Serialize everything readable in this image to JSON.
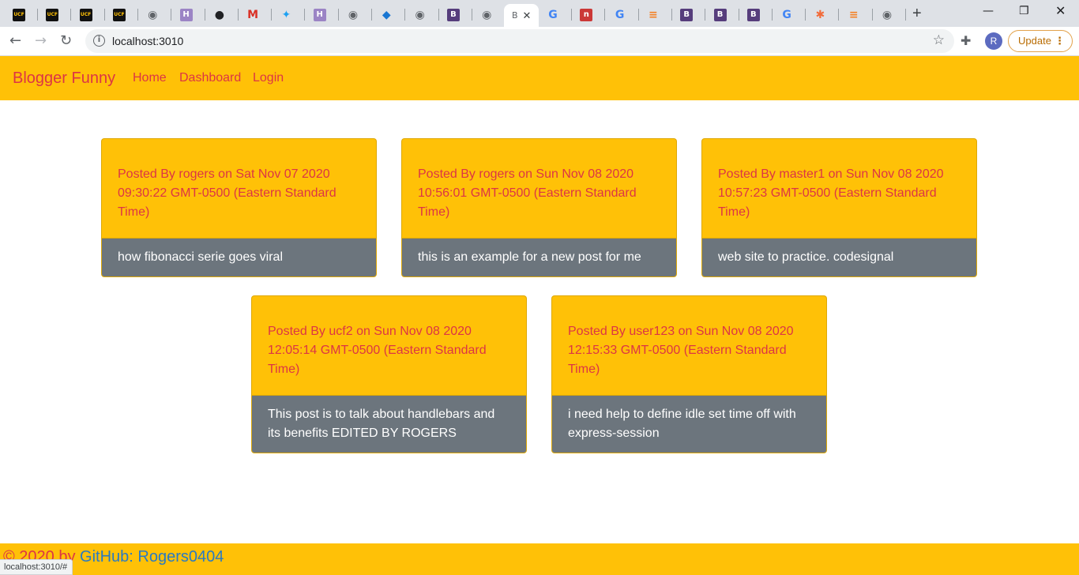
{
  "browser": {
    "tabs": [
      {
        "icon": "ucf-icon",
        "letter": "UCF",
        "color": "#111111"
      },
      {
        "icon": "ucf-icon",
        "letter": "UCF",
        "color": "#111111"
      },
      {
        "icon": "ucf-icon",
        "letter": "UCF",
        "color": "#111111"
      },
      {
        "icon": "ucf-icon",
        "letter": "UCF",
        "color": "#111111"
      },
      {
        "icon": "globe-icon",
        "letter": "◉",
        "color": "#5f6368"
      },
      {
        "icon": "heroku-icon",
        "letter": "H",
        "color": "#9b84c5"
      },
      {
        "icon": "github-icon",
        "letter": "●",
        "color": "#202124"
      },
      {
        "icon": "gmail-icon",
        "letter": "M",
        "color": "#d93025"
      },
      {
        "icon": "twitter-icon",
        "letter": "✦",
        "color": "#1da1f2"
      },
      {
        "icon": "heroku-icon",
        "letter": "H",
        "color": "#9b84c5"
      },
      {
        "icon": "globe-icon",
        "letter": "◉",
        "color": "#5f6368"
      },
      {
        "icon": "cube-icon",
        "letter": "◆",
        "color": "#1976d2"
      },
      {
        "icon": "globe-icon",
        "letter": "◉",
        "color": "#5f6368"
      },
      {
        "icon": "bootstrap-icon",
        "letter": "B",
        "color": "#563d7c"
      },
      {
        "icon": "globe-icon",
        "letter": "◉",
        "color": "#5f6368"
      }
    ],
    "tabs_right": [
      {
        "icon": "google-icon",
        "letter": "G",
        "color": "#4285f4"
      },
      {
        "icon": "npm-icon",
        "letter": "n",
        "color": "#cb3837"
      },
      {
        "icon": "google-icon",
        "letter": "G",
        "color": "#4285f4"
      },
      {
        "icon": "stackoverflow-icon",
        "letter": "≡",
        "color": "#f48024"
      },
      {
        "icon": "bootstrap-icon",
        "letter": "B",
        "color": "#563d7c"
      },
      {
        "icon": "bootstrap-icon",
        "letter": "B",
        "color": "#563d7c"
      },
      {
        "icon": "bootstrap-icon",
        "letter": "B",
        "color": "#563d7c"
      },
      {
        "icon": "google-icon",
        "letter": "G",
        "color": "#4285f4"
      },
      {
        "icon": "asterisk-icon",
        "letter": "✱",
        "color": "#f26b3a"
      },
      {
        "icon": "stackoverflow-icon",
        "letter": "≡",
        "color": "#f48024"
      },
      {
        "icon": "globe-icon",
        "letter": "◉",
        "color": "#5f6368"
      }
    ],
    "active_tab_letter": "B",
    "url": "localhost:3010",
    "update_label": "Update",
    "avatar_letter": "R",
    "status_url": "localhost:3010/#"
  },
  "app": {
    "brand": "Blogger Funny",
    "nav": [
      "Home",
      "Dashboard",
      "Login"
    ],
    "posts": [
      {
        "header": "Posted By rogers on Sat Nov 07 2020 09:30:22 GMT-0500 (Eastern Standard Time)",
        "body": "how fibonacci serie goes viral"
      },
      {
        "header": "Posted By rogers on Sun Nov 08 2020 10:56:01 GMT-0500 (Eastern Standard Time)",
        "body": "this is an example for a new post for me"
      },
      {
        "header": "Posted By master1 on Sun Nov 08 2020 10:57:23 GMT-0500 (Eastern Standard Time)",
        "body": "web site to practice. codesignal"
      },
      {
        "header": "Posted By ucf2 on Sun Nov 08 2020 12:05:14 GMT-0500 (Eastern Standard Time)",
        "body": "This post is to talk about handlebars and its benefits EDITED BY ROGERS"
      },
      {
        "header": "Posted By user123 on Sun Nov 08 2020 12:15:33 GMT-0500 (Eastern Standard Time)",
        "body": "i need help to define idle set time off with express-session"
      }
    ],
    "footer_copy": "© 2020 by ",
    "footer_link": "GitHub: Rogers0404"
  }
}
